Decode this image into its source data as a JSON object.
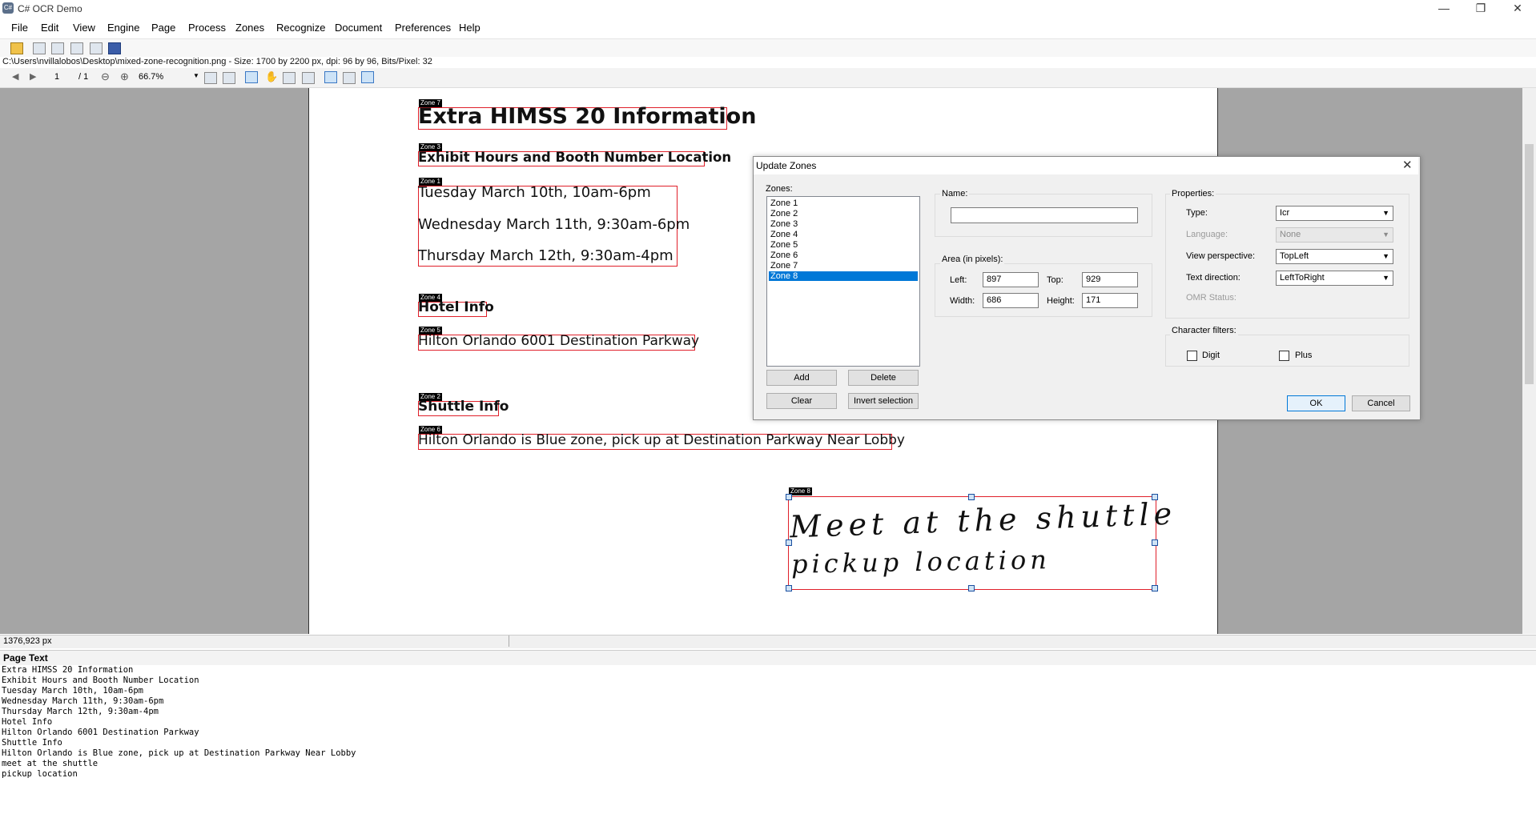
{
  "window": {
    "title": "C# OCR Demo",
    "minimize": "—",
    "maximize": "❐",
    "close": "✕"
  },
  "menu": [
    "File",
    "Edit",
    "View",
    "Engine",
    "Page",
    "Process",
    "Zones",
    "Recognize",
    "Document",
    "Preferences",
    "Help"
  ],
  "file_info": "C:\\Users\\nvillalobos\\Desktop\\mixed-zone-recognition.png - Size: 1700 by 2200 px, dpi: 96 by 96, Bits/Pixel: 32",
  "nav": {
    "page": "1",
    "total": "/ 1",
    "zoom": "66.7%"
  },
  "zones": [
    {
      "label": "Zone 7",
      "text": "Extra HIMSS 20 Information"
    },
    {
      "label": "Zone 3",
      "text": "Exhibit Hours and Booth Number Location"
    },
    {
      "label": "Zone 1",
      "lines": [
        "Tuesday March 10th, 10am-6pm",
        "Wednesday March 11th, 9:30am-6pm",
        "Thursday March 12th, 9:30am-4pm"
      ]
    },
    {
      "label": "Zone 4",
      "text": "Hotel Info"
    },
    {
      "label": "Zone 5",
      "text": "Hilton Orlando 6001 Destination Parkway"
    },
    {
      "label": "Zone 2",
      "text": "Shuttle Info"
    },
    {
      "label": "Zone 6",
      "text": "Hilton Orlando is Blue zone, pick up at Destination Parkway Near Lobby"
    },
    {
      "label": "Zone 8",
      "lines": [
        "Meet at the shuttle",
        "pickup location"
      ]
    }
  ],
  "status": {
    "coords": "1376,923 px"
  },
  "page_text": {
    "title": "Page Text",
    "lines": [
      "Extra HIMSS 20 Information",
      "Exhibit Hours and Booth Number Location",
      "Tuesday March 10th, 10am-6pm",
      "Wednesday March 11th, 9:30am-6pm",
      "Thursday March 12th, 9:30am-4pm",
      "Hotel Info",
      "Hilton Orlando 6001 Destination Parkway",
      "Shuttle Info",
      "Hilton Orlando is Blue zone, pick up at Destination Parkway Near Lobby",
      "meet at the shuttle",
      "pickup location"
    ]
  },
  "dialog": {
    "title": "Update Zones",
    "zones_label": "Zones:",
    "zone_items": [
      "Zone 1",
      "Zone 2",
      "Zone 3",
      "Zone 4",
      "Zone 5",
      "Zone 6",
      "Zone 7",
      "Zone 8"
    ],
    "selected_zone": "Zone 8",
    "add": "Add",
    "delete": "Delete",
    "clear": "Clear",
    "invert": "Invert selection",
    "name_label": "Name:",
    "name_value": "",
    "area_label": "Area (in pixels):",
    "left_label": "Left:",
    "left": "897",
    "top_label": "Top:",
    "top": "929",
    "width_label": "Width:",
    "width": "686",
    "height_label": "Height:",
    "height": "171",
    "properties_label": "Properties:",
    "type_label": "Type:",
    "type": "Icr",
    "language_label": "Language:",
    "language": "None",
    "view_label": "View perspective:",
    "view": "TopLeft",
    "textdir_label": "Text direction:",
    "textdir": "LeftToRight",
    "omr_label": "OMR Status:",
    "charfilters_label": "Character filters:",
    "digit": "Digit",
    "plus": "Plus",
    "ok": "OK",
    "cancel": "Cancel"
  }
}
